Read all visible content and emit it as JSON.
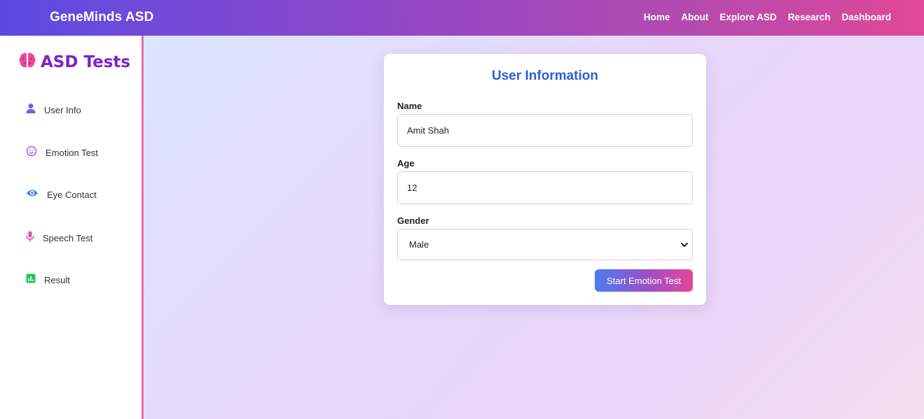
{
  "header": {
    "brand": "GeneMinds ASD",
    "nav": [
      "Home",
      "About",
      "Explore ASD",
      "Research",
      "Dashboard"
    ]
  },
  "sidebar": {
    "title": "ASD Tests",
    "title_icon": "brain-icon",
    "items": [
      {
        "label": "User Info",
        "icon": "user-icon",
        "color": "#6366f1"
      },
      {
        "label": "Emotion Test",
        "icon": "smile-icon",
        "color": "#a855f7"
      },
      {
        "label": "Eye Contact",
        "icon": "eye-icon",
        "color": "#3b82f6"
      },
      {
        "label": "Speech Test",
        "icon": "microphone-icon",
        "color": "#ec4899"
      },
      {
        "label": "Result",
        "icon": "chart-icon",
        "color": "#22c55e"
      }
    ]
  },
  "form": {
    "title": "User Information",
    "name_label": "Name",
    "name_value": "Amit Shah",
    "age_label": "Age",
    "age_value": "12",
    "gender_label": "Gender",
    "gender_value": "Male",
    "submit_label": "Start Emotion Test"
  },
  "colors": {
    "accent": "#7b22c9",
    "title_blue": "#2d5fd6",
    "pink": "#ec6aa8"
  }
}
